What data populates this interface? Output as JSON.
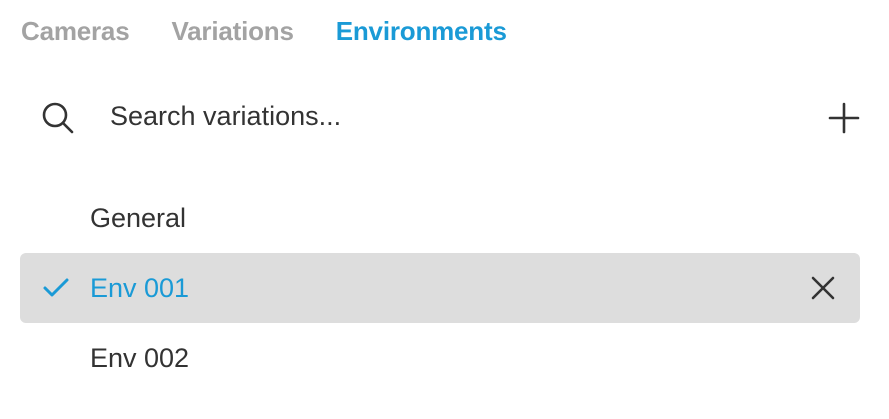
{
  "colors": {
    "accent": "#1a9ad6",
    "inactive_tab": "#a3a3a3",
    "text": "#333333",
    "selected_bg": "#dddddd"
  },
  "tabs": [
    {
      "label": "Cameras",
      "active": false
    },
    {
      "label": "Variations",
      "active": false
    },
    {
      "label": "Environments",
      "active": true
    }
  ],
  "search": {
    "placeholder": "Search variations...",
    "value": "",
    "icon": "search-icon",
    "add_icon": "plus-icon"
  },
  "list": {
    "items": [
      {
        "label": "General",
        "selected": false
      },
      {
        "label": "Env 001",
        "selected": true,
        "icon": "check-icon",
        "action_icon": "close-icon"
      },
      {
        "label": "Env 002",
        "selected": false
      }
    ]
  }
}
